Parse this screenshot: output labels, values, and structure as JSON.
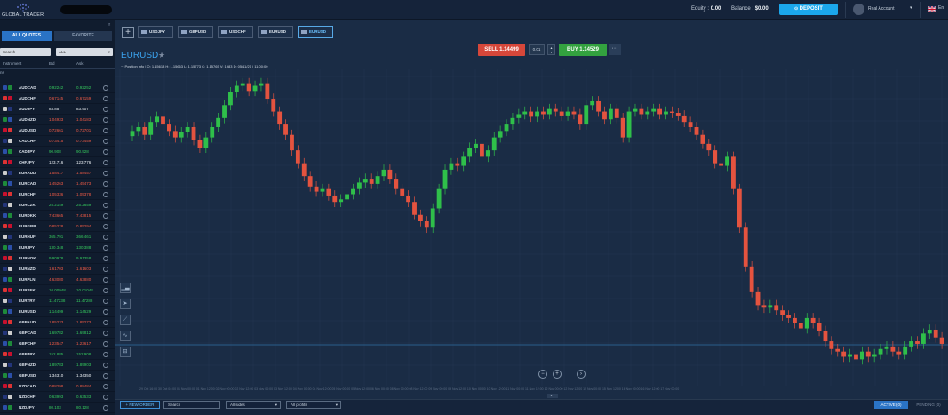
{
  "brand": {
    "name": "GLOBAL TRADER"
  },
  "topbar": {
    "equity_label": "Equity :",
    "equity_value": "0.00",
    "balance_label": "Balance :",
    "balance_value": "$0.00",
    "deposit_label": "DEPOSIT",
    "account_label": "Real Account",
    "language": "En"
  },
  "sidebar": {
    "tab_all": "ALL QUOTES",
    "tab_fav": "FAVORITE",
    "search_placeholder": "Search",
    "filter_value": "ALL",
    "col_instrument": "Instrument",
    "col_bid": "Bid",
    "col_ask": "Ask",
    "quotes": [
      {
        "symbol": "AUDCAD",
        "bid": "0.92242",
        "ask": "0.92252",
        "dir": "up"
      },
      {
        "symbol": "AUDCHF",
        "bid": "0.67145",
        "ask": "0.67159",
        "dir": "dn"
      },
      {
        "symbol": "AUDJPY",
        "bid": "83.857",
        "ask": "83.907",
        "dir": "wh"
      },
      {
        "symbol": "AUDNZD",
        "bid": "1.04933",
        "ask": "1.04183",
        "dir": "dn"
      },
      {
        "symbol": "AUDUSD",
        "bid": "0.72661",
        "ask": "0.72701",
        "dir": "dn"
      },
      {
        "symbol": "CADCHF",
        "bid": "0.73415",
        "ask": "0.73459",
        "dir": "dn"
      },
      {
        "symbol": "CADJPY",
        "bid": "90.908",
        "ask": "90.928",
        "dir": "up"
      },
      {
        "symbol": "CHFJPY",
        "bid": "123.716",
        "ask": "123.776",
        "dir": "wh"
      },
      {
        "symbol": "EURAUD",
        "bid": "1.58417",
        "ask": "1.58457",
        "dir": "dn"
      },
      {
        "symbol": "EURCAD",
        "bid": "1.45263",
        "ask": "1.45473",
        "dir": "dn"
      },
      {
        "symbol": "EURCHF",
        "bid": "1.05336",
        "ask": "1.05378",
        "dir": "dn"
      },
      {
        "symbol": "EURCZK",
        "bid": "25.2149",
        "ask": "25.2659",
        "dir": "up"
      },
      {
        "symbol": "EURDKK",
        "bid": "7.43665",
        "ask": "7.43815",
        "dir": "dn"
      },
      {
        "symbol": "EURGBP",
        "bid": "0.85228",
        "ask": "0.85294",
        "dir": "dn"
      },
      {
        "symbol": "EURHUF",
        "bid": "365.791",
        "ask": "366.461",
        "dir": "up"
      },
      {
        "symbol": "EURJPY",
        "bid": "130.348",
        "ask": "130.388",
        "dir": "up"
      },
      {
        "symbol": "EURNOK",
        "bid": "9.90978",
        "ask": "9.91358",
        "dir": "up"
      },
      {
        "symbol": "EURNZD",
        "bid": "1.61703",
        "ask": "1.61603",
        "dir": "dn"
      },
      {
        "symbol": "EURPLN",
        "bid": "4.63080",
        "ask": "4.63880",
        "dir": "dn"
      },
      {
        "symbol": "EURSEK",
        "bid": "10.00948",
        "ask": "10.01048",
        "dir": "up"
      },
      {
        "symbol": "EURTRY",
        "bid": "11.47238",
        "ask": "11.47288",
        "dir": "up"
      },
      {
        "symbol": "EURUSD",
        "bid": "1.14499",
        "ask": "1.14529",
        "dir": "up"
      },
      {
        "symbol": "GBPAUD",
        "bid": "1.85233",
        "ask": "1.85273",
        "dir": "dn"
      },
      {
        "symbol": "GBPCAD",
        "bid": "1.69782",
        "ask": "1.69812",
        "dir": "up"
      },
      {
        "symbol": "GBPCHF",
        "bid": "1.23547",
        "ask": "1.23617",
        "dir": "dn"
      },
      {
        "symbol": "GBPJPY",
        "bid": "152.885",
        "ask": "152.908",
        "dir": "up"
      },
      {
        "symbol": "GBPNZD",
        "bid": "1.89783",
        "ask": "1.89903",
        "dir": "up"
      },
      {
        "symbol": "GBPUSD",
        "bid": "1.34310",
        "ask": "1.34350",
        "dir": "wh"
      },
      {
        "symbol": "NZDCAD",
        "bid": "0.88298",
        "ask": "0.88484",
        "dir": "dn"
      },
      {
        "symbol": "NZDCHF",
        "bid": "0.63993",
        "ask": "0.63533",
        "dir": "up"
      },
      {
        "symbol": "NZDJPY",
        "bid": "80.103",
        "ask": "80.128",
        "dir": "up"
      }
    ]
  },
  "tabs": [
    {
      "label": "USDJPY",
      "active": false
    },
    {
      "label": "GBPUSD",
      "active": false
    },
    {
      "label": "USDCHF",
      "active": false
    },
    {
      "label": "EURUSD",
      "active": false
    },
    {
      "label": "EURUSD",
      "active": true
    }
  ],
  "chart": {
    "pair": "EURUSD",
    "position_info": "Position info",
    "ohlc": "O: 1.15613   H: 1.15663   L: 1.15773   C: 1.15765   V: 1983   D: 05/11/21 | 11:00:00",
    "sell_label": "SELL",
    "sell_price": "1.14499",
    "lot": "0.01",
    "buy_label": "BUY",
    "buy_price": "1.14529",
    "more_label": "···",
    "time_axis": "29 Oct 16:00   30 Oct 04:00   01 Nov 00:00   01 Nov 12:00   02 Nov 00:00   02 Nov 12:00   03 Nov 00:00   03 Nov 12:00   04 Nov 00:00   04 Nov 12:00   05 Nov 00:00   05 Nov 12:00   06 Nov 00:00   08 Nov 00:00   08 Nov 12:00   09 Nov 00:00   09 Nov 12:00   10 Nov 00:00   10 Nov 12:00   11 Nov 00:00   11 Nov 12:00   12 Nov 00:00   12 Nov 12:00   15 Nov 00:00   15 Nov 12:00   16 Nov 00:00   16 Nov 12:00   17 Nov 00:00"
  },
  "bottom": {
    "new_order": "+ NEW ORDER",
    "search_placeholder": "Search",
    "sides": "All sides",
    "profits": "All profits",
    "active": "ACTIVE (0)",
    "pending": "PENDING (0)"
  },
  "chart_data": {
    "type": "candlestick",
    "title": "EURUSD",
    "series": [
      {
        "name": "EURUSD",
        "closes": [
          1.1615,
          1.1618,
          1.1612,
          1.1622,
          1.1626,
          1.162,
          1.1615,
          1.161,
          1.1614,
          1.1618,
          1.1608,
          1.1602,
          1.161,
          1.1618,
          1.1625,
          1.1635,
          1.1645,
          1.165,
          1.1652,
          1.1646,
          1.165,
          1.1652,
          1.164,
          1.163,
          1.162,
          1.1612,
          1.16,
          1.159,
          1.158,
          1.1572,
          1.1568,
          1.157,
          1.1565,
          1.156,
          1.1562,
          1.1566,
          1.157,
          1.1575,
          1.1578,
          1.1574,
          1.158,
          1.1585,
          1.1578,
          1.157,
          1.1565,
          1.156,
          1.155,
          1.1545,
          1.154,
          1.1555,
          1.157,
          1.1585,
          1.159,
          1.1588,
          1.1595,
          1.1602,
          1.1605,
          1.1595,
          1.16,
          1.161,
          1.1615,
          1.162,
          1.1625,
          1.1628,
          1.163,
          1.1626,
          1.163,
          1.1628,
          1.1632,
          1.163,
          1.1627,
          1.163,
          1.1628,
          1.162,
          1.1635,
          1.1638,
          1.163,
          1.1624,
          1.1632,
          1.1625,
          1.161,
          1.163,
          1.1632,
          1.1628,
          1.163,
          1.1632,
          1.1628,
          1.163,
          1.1629,
          1.1627,
          1.1622,
          1.1618,
          1.1612,
          1.1605,
          1.16,
          1.159,
          1.1588,
          1.1595,
          1.157,
          1.154,
          1.151,
          1.149,
          1.148,
          1.1478,
          1.148,
          1.1476,
          1.1472,
          1.147,
          1.1466,
          1.1462,
          1.147,
          1.1466,
          1.146,
          1.1452,
          1.1446,
          1.1444,
          1.144,
          1.1442,
          1.1438,
          1.1444,
          1.144,
          1.1442,
          1.1446,
          1.1448,
          1.1444,
          1.1442,
          1.1448,
          1.1452,
          1.145,
          1.1458,
          1.1461,
          1.1455,
          1.145
        ]
      }
    ],
    "price_line": 1.14499
  }
}
